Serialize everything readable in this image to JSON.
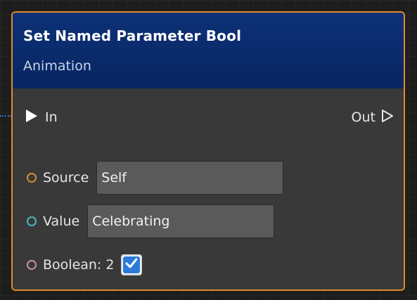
{
  "node": {
    "title": "Set Named Parameter Bool",
    "category": "Animation",
    "colors": {
      "border": "#e08a2c",
      "header": "#0d3178",
      "body": "#393939"
    }
  },
  "exec": {
    "in_label": "In",
    "out_label": "Out",
    "in_icon": "play-filled-icon",
    "out_icon": "play-outline-icon"
  },
  "pins": {
    "source": {
      "label": "Source",
      "value": "Self",
      "color": "#d98a3a"
    },
    "value": {
      "label": "Value",
      "value": "Celebrating",
      "color": "#45b8c0"
    },
    "boolean": {
      "label": "Boolean: 2",
      "checked": true,
      "color": "#c88aa8"
    }
  }
}
